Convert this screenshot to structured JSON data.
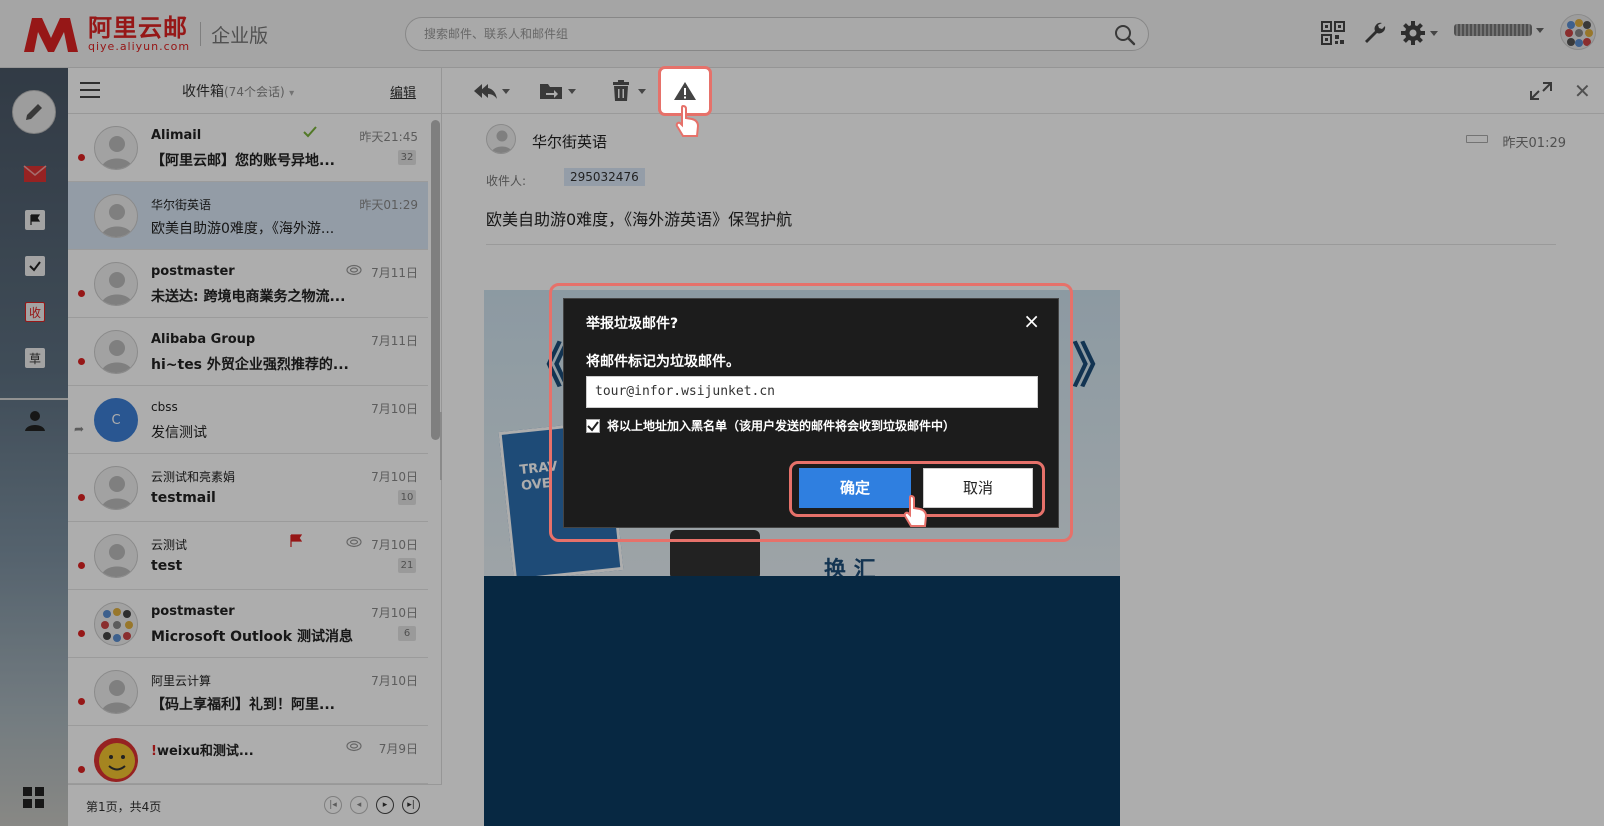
{
  "brand": {
    "name": "阿里云邮",
    "domain": "qiye.aliyun.com",
    "edition": "企业版",
    "color": "#dd2222"
  },
  "search": {
    "placeholder": "搜索邮件、联系人和邮件组"
  },
  "sidebar": {
    "items": [
      {
        "icon": "pencil-icon",
        "label": ""
      },
      {
        "icon": "mail-icon",
        "label": ""
      },
      {
        "icon": "flag-icon",
        "label": ""
      },
      {
        "icon": "check-icon",
        "label": ""
      },
      {
        "icon": "receive-icon",
        "label": "收"
      },
      {
        "icon": "draft-icon",
        "label": "草"
      },
      {
        "icon": "contacts-icon",
        "label": ""
      }
    ]
  },
  "list": {
    "folder_title": "收件箱",
    "folder_count": "(74个会话)",
    "edit_label": "编辑",
    "page_info": "第1页，共4页",
    "items": [
      {
        "sender": "Alimail",
        "subject": "【阿里云邮】您的账号异地...",
        "date": "昨天21:45",
        "badge": "32",
        "unread": true
      },
      {
        "sender": "华尔街英语",
        "subject": "欧美自助游0难度，《海外游...",
        "date": "昨天01:29",
        "badge": "",
        "unread": false
      },
      {
        "sender": "postmaster",
        "subject": "未送达: 跨境电商業务之物流...",
        "date": "7月11日",
        "badge": "",
        "unread": true
      },
      {
        "sender": "Alibaba Group",
        "subject": "hi~tes 外贸企业强烈推荐的...",
        "date": "7月11日",
        "badge": "",
        "unread": true
      },
      {
        "sender": "cbss",
        "subject": "发信测试",
        "date": "7月10日",
        "badge": "",
        "unread": false,
        "avatar_letter": "C"
      },
      {
        "sender": "云测试和亮素娟",
        "subject": "testmail",
        "date": "7月10日",
        "badge": "10",
        "unread": true
      },
      {
        "sender": "云测试",
        "subject": "test",
        "date": "7月10日",
        "badge": "21",
        "unread": true
      },
      {
        "sender": "postmaster",
        "subject": "Microsoft Outlook 测试消息",
        "date": "7月10日",
        "badge": "6",
        "unread": true
      },
      {
        "sender": "阿里云计算",
        "subject": "【码上享福利】礼到！阿里...",
        "date": "7月10日",
        "badge": "",
        "unread": true
      },
      {
        "sender": "weixu和测试...",
        "subject": "",
        "date": "7月9日",
        "badge": "",
        "unread": true
      }
    ]
  },
  "reader": {
    "sender_name": "华尔街英语",
    "date": "昨天01:29",
    "to_label": "收件人:",
    "to_value": "295032476",
    "subject": "欧美自助游0难度，《海外游英语》保驾护航"
  },
  "dialog": {
    "title": "举报垃圾邮件?",
    "close": "×",
    "description": "将邮件标记为垃圾邮件。",
    "address": "tour@infor.wsijunket.cn",
    "blacklist_label": "将以上地址加入黑名单（该用户发送的邮件将会收到垃圾邮件中）",
    "blacklist_checked": true,
    "ok_label": "确定",
    "cancel_label": "取消"
  },
  "colors": {
    "accent": "#2f7fe0",
    "highlight": "#e6716a",
    "unread": "#dd2222"
  }
}
